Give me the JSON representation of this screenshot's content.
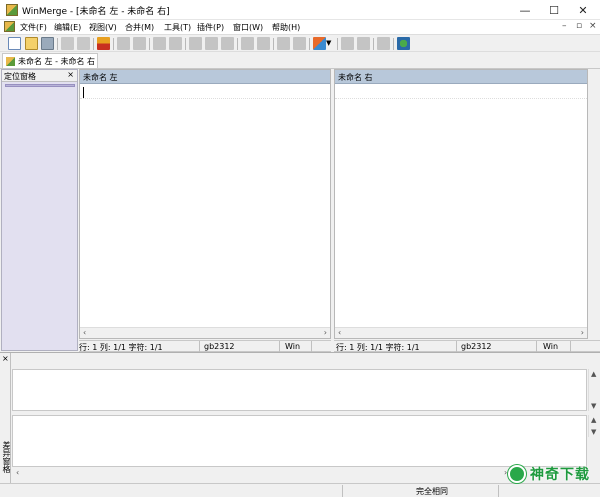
{
  "window": {
    "title": "WinMerge - [未命名 左 - 未命名 右]",
    "minimize_glyph": "—",
    "maximize_glyph": "☐",
    "close_glyph": "✕"
  },
  "menu": {
    "items": [
      "文件(F)",
      "编辑(E)",
      "视图(V)",
      "合并(M)",
      "工具(T)",
      "插件(P)",
      "窗口(W)",
      "帮助(H)"
    ],
    "mdi_minimize": "–",
    "mdi_restore": "▫",
    "mdi_close": "×"
  },
  "toolbar": {
    "icons": [
      "new-icon",
      "open-icon",
      "save-icon",
      "undo-icon",
      "redo-icon",
      "options-icon",
      "first-diff-icon",
      "prev-diff-icon",
      "next-diff-icon",
      "last-diff-icon",
      "current-diff-icon",
      "copy-right-icon",
      "copy-left-icon",
      "copy-right-advance-icon",
      "copy-left-advance-icon",
      "all-right-icon",
      "all-left-icon",
      "compare-icon",
      "filter-icon",
      "prev-file-icon",
      "next-file-icon",
      "merge-icon",
      "refresh-icon"
    ]
  },
  "tab": {
    "label": "未命名 左 - 未命名 右"
  },
  "location_pane": {
    "title": "定位窗格",
    "close": "×"
  },
  "left_pane": {
    "title": "未命名 左",
    "status": {
      "position": "行: 1  列: 1/1  字符: 1/1",
      "encoding": "gb2312",
      "eol": "Win"
    }
  },
  "right_pane": {
    "title": "未命名 右",
    "status": {
      "position": "行: 1  列: 1/1  字符: 1/1",
      "encoding": "gb2312",
      "eol": "Win"
    }
  },
  "diff_pane": {
    "title": "差异窗格",
    "close": "×"
  },
  "statusbar": {
    "message": "完全相同"
  },
  "scroll": {
    "left": "‹",
    "right": "›",
    "up": "▲",
    "down": "▼"
  },
  "watermark": {
    "text": "神奇下载"
  }
}
